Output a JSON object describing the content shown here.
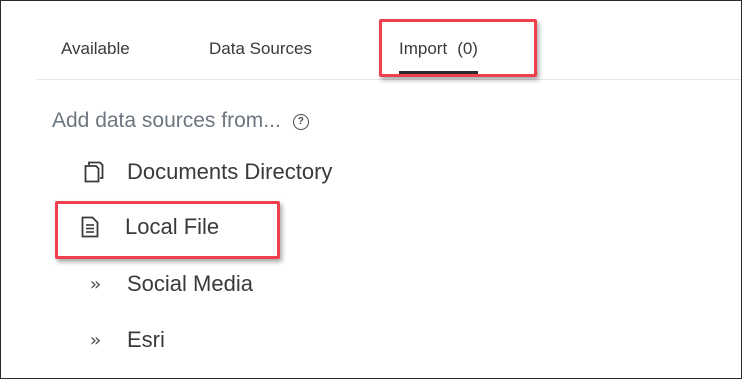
{
  "tabs": [
    {
      "label": "Available"
    },
    {
      "label": "Data Sources"
    },
    {
      "label": "Import",
      "count": "(0)",
      "active": true
    }
  ],
  "section": {
    "heading": "Add data sources from...",
    "help_icon": "help-circle-icon"
  },
  "sources": [
    {
      "label": "Documents Directory",
      "icon": "documents-icon"
    },
    {
      "label": "Local File",
      "icon": "file-icon"
    },
    {
      "label": "Social Media",
      "icon": "chevron-double-right-icon"
    },
    {
      "label": "Esri",
      "icon": "chevron-double-right-icon"
    }
  ],
  "colors": {
    "highlight": "#ef4050",
    "heading": "#6d7680",
    "text": "#3a3a3a"
  }
}
